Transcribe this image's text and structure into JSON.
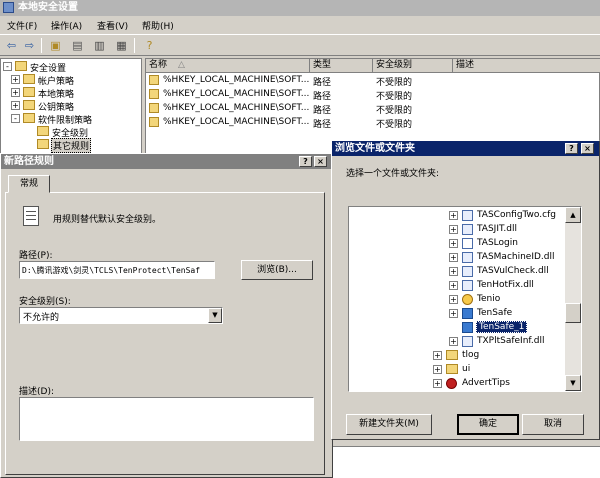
{
  "window": {
    "title": "本地安全设置"
  },
  "menu": [
    "文件(F)",
    "操作(A)",
    "查看(V)",
    "帮助(H)"
  ],
  "tree": {
    "items": [
      {
        "label": "安全设置",
        "level": 0,
        "expander": "-"
      },
      {
        "label": "帐户策略",
        "level": 1,
        "expander": "+"
      },
      {
        "label": "本地策略",
        "level": 1,
        "expander": "+"
      },
      {
        "label": "公钥策略",
        "level": 1,
        "expander": "+"
      },
      {
        "label": "软件限制策略",
        "level": 1,
        "expander": "-"
      },
      {
        "label": "安全级别",
        "level": 2,
        "expander": ""
      },
      {
        "label": "其它规则",
        "level": 2,
        "expander": "",
        "selected": true
      }
    ]
  },
  "list": {
    "columns": [
      "名称",
      "类型",
      "安全级别",
      "描述"
    ],
    "rows": [
      {
        "name": "%HKEY_LOCAL_MACHINE\\SOFT...",
        "type": "路径",
        "level": "不受限的"
      },
      {
        "name": "%HKEY_LOCAL_MACHINE\\SOFT...",
        "type": "路径",
        "level": "不受限的"
      },
      {
        "name": "%HKEY_LOCAL_MACHINE\\SOFT...",
        "type": "路径",
        "level": "不受限的"
      },
      {
        "name": "%HKEY_LOCAL_MACHINE\\SOFT...",
        "type": "路径",
        "level": "不受限的"
      }
    ]
  },
  "rule_dialog": {
    "title": "新路径规则",
    "help": "?",
    "close": "×",
    "tab": "常规",
    "intro": "用规则替代默认安全级别。",
    "path_label": "路径(P):",
    "path_value": "D:\\腾讯游戏\\剑灵\\TCLS\\TenProtect\\TenSaf",
    "browse_label": "浏览(B)...",
    "level_label": "安全级别(S):",
    "level_value": "不允许的",
    "desc_label": "描述(D):",
    "desc_value": ""
  },
  "browse_dialog": {
    "title": "浏览文件或文件夹",
    "help": "?",
    "close": "×",
    "prompt": "选择一个文件或文件夹:",
    "items": [
      {
        "label": "TASConfigTwo.cfg",
        "icon": "cfg-file",
        "expander": "+",
        "level": 2
      },
      {
        "label": "TASJIT.dll",
        "icon": "dll-file",
        "expander": "+",
        "level": 2
      },
      {
        "label": "TASLogin",
        "icon": "blank-file",
        "expander": "+",
        "level": 2
      },
      {
        "label": "TASMachineID.dll",
        "icon": "dll-file",
        "expander": "+",
        "level": 2
      },
      {
        "label": "TASVulCheck.dll",
        "icon": "dll-file",
        "expander": "+",
        "level": 2
      },
      {
        "label": "TenHotFix.dll",
        "icon": "dll-file",
        "expander": "+",
        "level": 2
      },
      {
        "label": "Tenio",
        "icon": "app-file",
        "expander": "+",
        "level": 2
      },
      {
        "label": "TenSafe",
        "icon": "tp-file",
        "expander": "+",
        "level": 2
      },
      {
        "label": "TenSafe_1",
        "icon": "tp-file",
        "expander": "",
        "level": 2,
        "selected": true
      },
      {
        "label": "TXPltSafeInf.dll",
        "icon": "dll-file",
        "expander": "+",
        "level": 2
      },
      {
        "label": "tlog",
        "icon": "folder",
        "expander": "+",
        "level": 1
      },
      {
        "label": "ui",
        "icon": "folder",
        "expander": "+",
        "level": 1
      },
      {
        "label": "AdvertTips",
        "icon": "app-file",
        "expander": "+",
        "level": 1
      }
    ],
    "new_folder_label": "新建文件夹(M)",
    "ok_label": "确定",
    "cancel_label": "取消"
  },
  "colors": {
    "title_active": "#0a246a",
    "title_inactive": "#808080",
    "selection": "#0a246a"
  }
}
